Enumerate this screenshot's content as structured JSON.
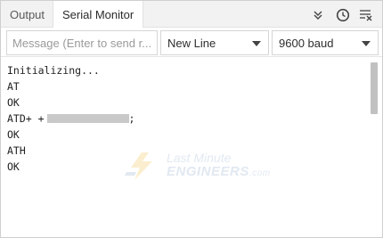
{
  "tabs": [
    {
      "label": "Output",
      "active": false
    },
    {
      "label": "Serial Monitor",
      "active": true
    }
  ],
  "header_icons": [
    "autoscroll-icon",
    "timestamp-icon",
    "clear-output-icon"
  ],
  "toolbar": {
    "message_placeholder": "Message (Enter to send r...",
    "line_ending": "New Line",
    "baud_rate": "9600 baud"
  },
  "console": {
    "lines": [
      "Initializing...",
      "AT",
      "OK",
      "ATD+ +",
      "OK",
      "ATH",
      "OK"
    ],
    "redacted_suffix": ";"
  },
  "watermark": {
    "top": "Last Minute",
    "bottom": "ENGINEERS",
    "suffix": ".com"
  },
  "colors": {
    "tabbar_bg": "#f2f2f2",
    "watermark": "#7a9bc4",
    "scroll_thumb": "#c1c1c1"
  }
}
